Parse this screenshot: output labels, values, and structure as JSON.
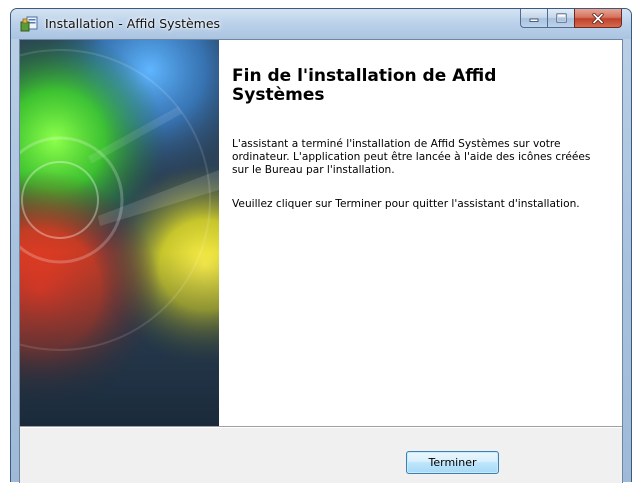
{
  "window": {
    "title": "Installation - Affid Systèmes",
    "controls": {
      "minimize": "minimize-icon",
      "maximize": "maximize-icon",
      "close": "close-icon"
    }
  },
  "wizard": {
    "heading": "Fin de l'installation de Affid Systèmes",
    "paragraph1": "L'assistant a terminé l'installation de Affid Systèmes sur votre ordinateur. L'application peut être lancée à l'aide des icônes créées sur le Bureau par l'installation.",
    "paragraph2": "Veuillez cliquer sur Terminer pour quitter l'assistant d'installation."
  },
  "buttons": {
    "finish_label": "Terminer"
  },
  "colors": {
    "titlebar": "#bcd2ea",
    "close_button": "#c0422c",
    "footer": "#f0f0f0",
    "default_button_border": "#3c7fb1"
  }
}
